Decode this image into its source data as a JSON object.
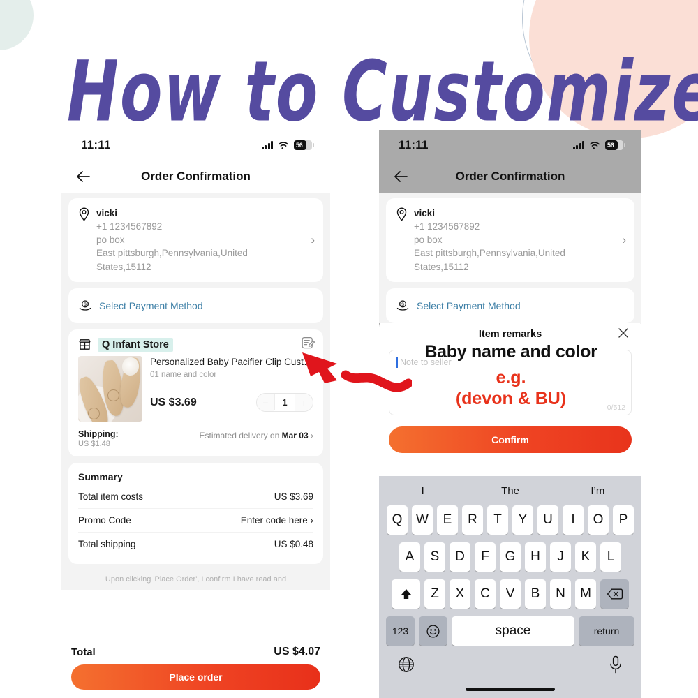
{
  "title": "How to Customize",
  "theme": {
    "title_color": "#554ba0",
    "accent_orange": "#f4702f",
    "accent_red": "#e8301a",
    "highlight_mint": "#d8f0ec",
    "link_blue": "#3d7fa6",
    "blob_pink": "#fbdfd6",
    "blob_mint": "#e4eeeb"
  },
  "left_phone": {
    "status_bar": {
      "time": "11:11",
      "battery_level": "56",
      "signal_icon": "cellular-signal-icon",
      "wifi_icon": "wifi-icon",
      "battery_icon": "battery-icon"
    },
    "nav": {
      "back_icon": "back-arrow-icon",
      "title": "Order Confirmation"
    },
    "address": {
      "pin_icon": "location-pin-icon",
      "name": "vicki",
      "phone": "+1 1234567892",
      "line1": "po box",
      "line2": "East pittsburgh,Pennsylvania,United",
      "line3": "States,15112",
      "chevron_icon": "chevron-right-icon"
    },
    "payment": {
      "icon": "payment-method-icon",
      "label": "Select Payment Method"
    },
    "store": {
      "icon": "storefront-icon",
      "name": "Q Infant Store",
      "edit_icon": "note-edit-icon"
    },
    "product": {
      "image_alt": "wooden-baby-brush-set",
      "title": "Personalized Baby Pacifier Clip Custo…",
      "variant": "01 name and color",
      "price": "US $3.69",
      "qty_minus": "−",
      "qty": "1",
      "qty_plus": "+"
    },
    "shipping": {
      "label": "Shipping:",
      "cost": "US $1.48",
      "estimate_prefix": "Estimated delivery on",
      "estimate_date": "Mar 03",
      "chevron": "›"
    },
    "summary": {
      "heading": "Summary",
      "rows": [
        {
          "label": "Total item costs",
          "value": "US $3.69"
        },
        {
          "label": "Promo Code",
          "value": "Enter code here ›"
        },
        {
          "label": "Total shipping",
          "value": "US $0.48"
        }
      ]
    },
    "disclaimer": "Upon clicking 'Place Order', I confirm I have read and",
    "footer": {
      "total_label": "Total",
      "total_value": "US $4.07",
      "cta": "Place order"
    }
  },
  "right_phone": {
    "status_bar": {
      "time": "11:11",
      "battery_level": "56"
    },
    "nav": {
      "back_icon": "back-arrow-icon",
      "title": "Order Confirmation"
    },
    "address": {
      "name": "vicki",
      "phone": "+1 1234567892",
      "line1": "po box",
      "line2": "East pittsburgh,Pennsylvania,United",
      "line3": "States,15112"
    },
    "payment_label": "Select Payment Method",
    "modal": {
      "title": "Item remarks",
      "close_icon": "close-x-icon",
      "note_placeholder": "Note to seller",
      "char_count": "0/512",
      "confirm": "Confirm"
    },
    "annotation": {
      "heading": "Baby name and color",
      "example_label": "e.g.",
      "example_value": "(devon & BU)",
      "arrow": "red-wavy-arrow"
    },
    "keyboard": {
      "suggestions": [
        "I",
        "The",
        "I’m"
      ],
      "row1": [
        "Q",
        "W",
        "E",
        "R",
        "T",
        "Y",
        "U",
        "I",
        "O",
        "P"
      ],
      "row2": [
        "A",
        "S",
        "D",
        "F",
        "G",
        "H",
        "J",
        "K",
        "L"
      ],
      "row3": [
        "Z",
        "X",
        "C",
        "V",
        "B",
        "N",
        "M"
      ],
      "shift_icon": "shift-arrow-icon",
      "backspace_icon": "backspace-icon",
      "numbers_key": "123",
      "emoji_icon": "emoji-smiley-icon",
      "space_key": "space",
      "return_key": "return",
      "globe_icon": "globe-icon",
      "mic_icon": "microphone-icon"
    }
  }
}
